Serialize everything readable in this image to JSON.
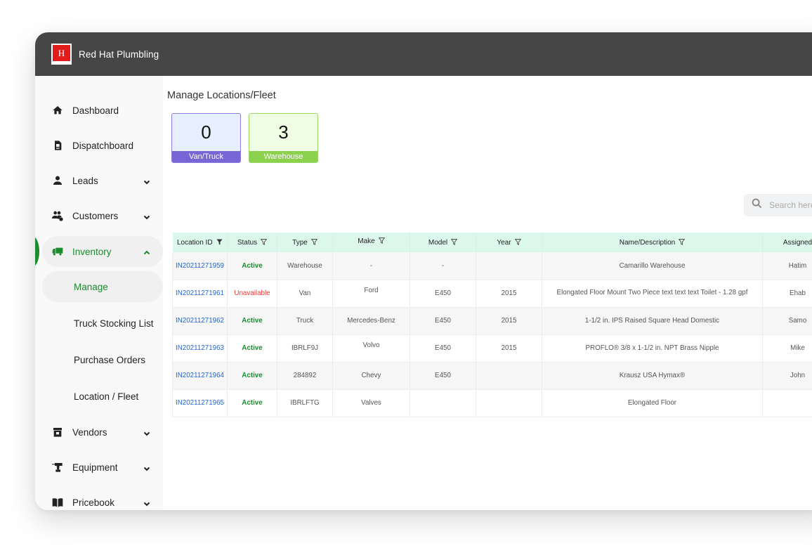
{
  "app": {
    "brand": "Red Hat Plumbling",
    "logo_glyph": "H"
  },
  "sidebar": {
    "items": [
      {
        "label": "Dashboard",
        "icon": "home-icon"
      },
      {
        "label": "Dispatchboard",
        "icon": "document-icon"
      },
      {
        "label": "Leads",
        "icon": "person-icon",
        "expandable": true
      },
      {
        "label": "Customers",
        "icon": "customers-icon",
        "expandable": true
      },
      {
        "label": "Inventory",
        "icon": "truck-icon",
        "expandable": true,
        "expanded": true,
        "active": true
      },
      {
        "label": "Vendors",
        "icon": "store-icon",
        "expandable": true
      },
      {
        "label": "Equipment",
        "icon": "drill-icon",
        "expandable": true
      },
      {
        "label": "Pricebook",
        "icon": "book-icon",
        "expandable": true
      }
    ],
    "inventory_sub": [
      {
        "label": "Manage",
        "active": true
      },
      {
        "label": "Truck Stocking List"
      },
      {
        "label": "Purchase Orders"
      },
      {
        "label": "Location / Fleet"
      }
    ]
  },
  "main": {
    "title": "Manage Locations/Fleet",
    "stats": [
      {
        "value": "0",
        "label": "Van/Truck",
        "color": "#7966d6"
      },
      {
        "value": "3",
        "label": "Warehouse",
        "color": "#8cd14d"
      }
    ],
    "search": {
      "placeholder": "Search here",
      "value": ""
    },
    "table": {
      "columns": [
        "Location ID",
        "Status",
        "Type",
        "Make",
        "Model",
        "Year",
        "Name/Description",
        "Assigned"
      ],
      "rows": [
        {
          "id": "IN20211271959",
          "status": "Active",
          "type": "Warehouse",
          "make": "-",
          "model": "-",
          "year": "",
          "desc": "Camarillo Warehouse",
          "assigned": "Hatim"
        },
        {
          "id": "IN20211271961",
          "status": "Unavailable",
          "type": "Van",
          "make": "Ford",
          "model": "E450",
          "year": "2015",
          "desc": "Elongated Floor Mount Two Piece text text text Toilet - 1.28 gpf",
          "assigned": "Ehab"
        },
        {
          "id": "IN20211271962",
          "status": "Active",
          "type": "Truck",
          "make": "Mercedes-Benz",
          "model": "E450",
          "year": "2015",
          "desc": "1-1/2 in. IPS Raised Square Head Domestic",
          "assigned": "Samo"
        },
        {
          "id": "IN20211271963",
          "status": "Active",
          "type": "IBRLF9J",
          "make": "Volvo",
          "model": "E450",
          "year": "2015",
          "desc": "PROFLO® 3/8 x 1-1/2 in. NPT Brass Nipple",
          "assigned": "Mike"
        },
        {
          "id": "IN20211271964",
          "status": "Active",
          "type": "284892",
          "make": "Chevy",
          "model": "E450",
          "year": "",
          "desc": "Krausz USA Hymax®",
          "assigned": "John"
        },
        {
          "id": "IN20211271965",
          "status": "Active",
          "type": "IBRLFTG",
          "make": "Valves",
          "model": "",
          "year": "",
          "desc": "Elongated Floor",
          "assigned": ""
        }
      ]
    }
  },
  "colors": {
    "topbar": "#464646",
    "accent_green": "#1c8a2f",
    "link_blue": "#2366d1",
    "unavailable_red": "#e53935",
    "table_header": "#dcf7ec"
  }
}
